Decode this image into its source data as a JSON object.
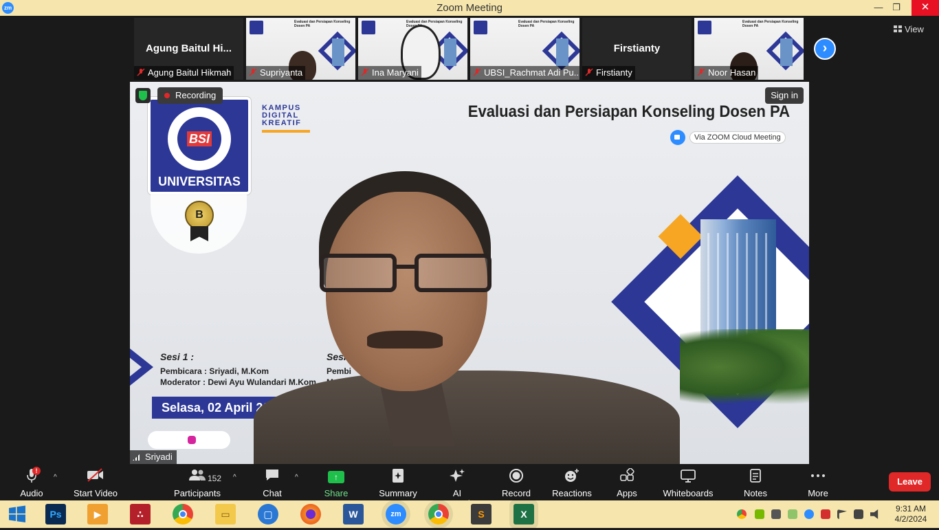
{
  "window": {
    "title": "Zoom Meeting",
    "logo_text": "zm",
    "min_glyph": "—",
    "max_glyph": "❐",
    "close_glyph": "✕"
  },
  "thumbnails": [
    {
      "name": "Agung Baitul Hikmah",
      "display_name": "Agung Baitul Hi...",
      "has_video": false,
      "muted": true
    },
    {
      "name": "Supriyanta",
      "has_video": true,
      "muted": true
    },
    {
      "name": "Ina Maryani",
      "has_video": true,
      "muted": true
    },
    {
      "name": "UBSI_Rachmat Adi Pu...",
      "has_video": true,
      "muted": true
    },
    {
      "name": "Firstianty",
      "display_name": "Firstianty",
      "has_video": false,
      "muted": true
    },
    {
      "name": "Noor Hasan",
      "has_video": true,
      "muted": true
    }
  ],
  "view_button": {
    "label": "View",
    "icon": "grid-icon"
  },
  "next_arrow": {
    "icon": "chevron-right-icon",
    "glyph": "›"
  },
  "main_video": {
    "recording_label": "Recording",
    "sign_in_label": "Sign in",
    "speaker_name": "Sriyadi",
    "slide": {
      "title": "Evaluasi dan Persiapan Konseling Dosen PA",
      "via_zoom": "Via ZOOM Cloud Meeting",
      "kampus_line1": "KAMPUS",
      "kampus_line2": "DIGITAL",
      "kampus_line3": "KREATIF",
      "logo_bsi": "BSI",
      "logo_university": "UNIVERSITAS",
      "seal_letter": "B",
      "sesi1_heading": "Sesi 1 :",
      "sesi1_pembicara": "Pembicara : Sriyadi, M.Kom",
      "sesi1_moderator": "Moderator : Dewi Ayu Wulandari M.Kom",
      "sesi2_heading": "Sesi",
      "sesi2_pembicara": "Pembi",
      "sesi2_moderator": "Modera",
      "date": "Selasa, 02 April 2024"
    }
  },
  "toolbar": {
    "audio": {
      "label": "Audio",
      "icon": "microphone-icon",
      "alert": "!"
    },
    "start_video": {
      "label": "Start Video",
      "icon": "video-off-icon"
    },
    "participants": {
      "label": "Participants",
      "icon": "participants-icon",
      "count": "152"
    },
    "chat": {
      "label": "Chat",
      "icon": "chat-icon"
    },
    "share_screen": {
      "label": "Share Screen",
      "icon": "share-screen-icon",
      "glyph": "↑"
    },
    "summary": {
      "label": "Summary",
      "icon": "summary-icon"
    },
    "ai_companion": {
      "label": "AI Companion",
      "icon": "sparkle-icon"
    },
    "record": {
      "label": "Record",
      "icon": "record-icon"
    },
    "reactions": {
      "label": "Reactions",
      "icon": "reactions-icon"
    },
    "apps": {
      "label": "Apps",
      "icon": "apps-icon"
    },
    "whiteboards": {
      "label": "Whiteboards",
      "icon": "whiteboard-icon"
    },
    "notes": {
      "label": "Notes",
      "icon": "notes-icon"
    },
    "more": {
      "label": "More",
      "icon": "more-icon"
    },
    "leave": {
      "label": "Leave"
    },
    "caret": "^"
  },
  "taskbar": {
    "apps": [
      {
        "name": "windows-start",
        "icon": "windows-logo-icon"
      },
      {
        "name": "photoshop",
        "icon": "photoshop-icon",
        "text": "Ps"
      },
      {
        "name": "media-player",
        "icon": "media-player-icon"
      },
      {
        "name": "mendeley",
        "icon": "mendeley-icon"
      },
      {
        "name": "chrome",
        "icon": "chrome-icon"
      },
      {
        "name": "file-explorer",
        "icon": "folder-icon"
      },
      {
        "name": "remote-desktop",
        "icon": "monitor-icon"
      },
      {
        "name": "firefox",
        "icon": "firefox-icon"
      },
      {
        "name": "word",
        "icon": "word-icon",
        "text": "W"
      },
      {
        "name": "zoom",
        "icon": "zoom-icon",
        "text": "zm"
      },
      {
        "name": "chrome-profile",
        "icon": "chrome-icon"
      },
      {
        "name": "sublime",
        "icon": "sublime-icon",
        "text": "S"
      },
      {
        "name": "excel",
        "icon": "excel-icon",
        "text": "X"
      }
    ],
    "clock_time": "9:31 AM",
    "clock_date": "4/2/2024"
  },
  "colors": {
    "titlebar_bg": "#f6e6ad",
    "zoom_blue": "#2d8cff",
    "leave_red": "#e02828",
    "share_green": "#1fbf4b",
    "bsi_blue": "#2c3796",
    "accent_orange": "#f6a623"
  }
}
